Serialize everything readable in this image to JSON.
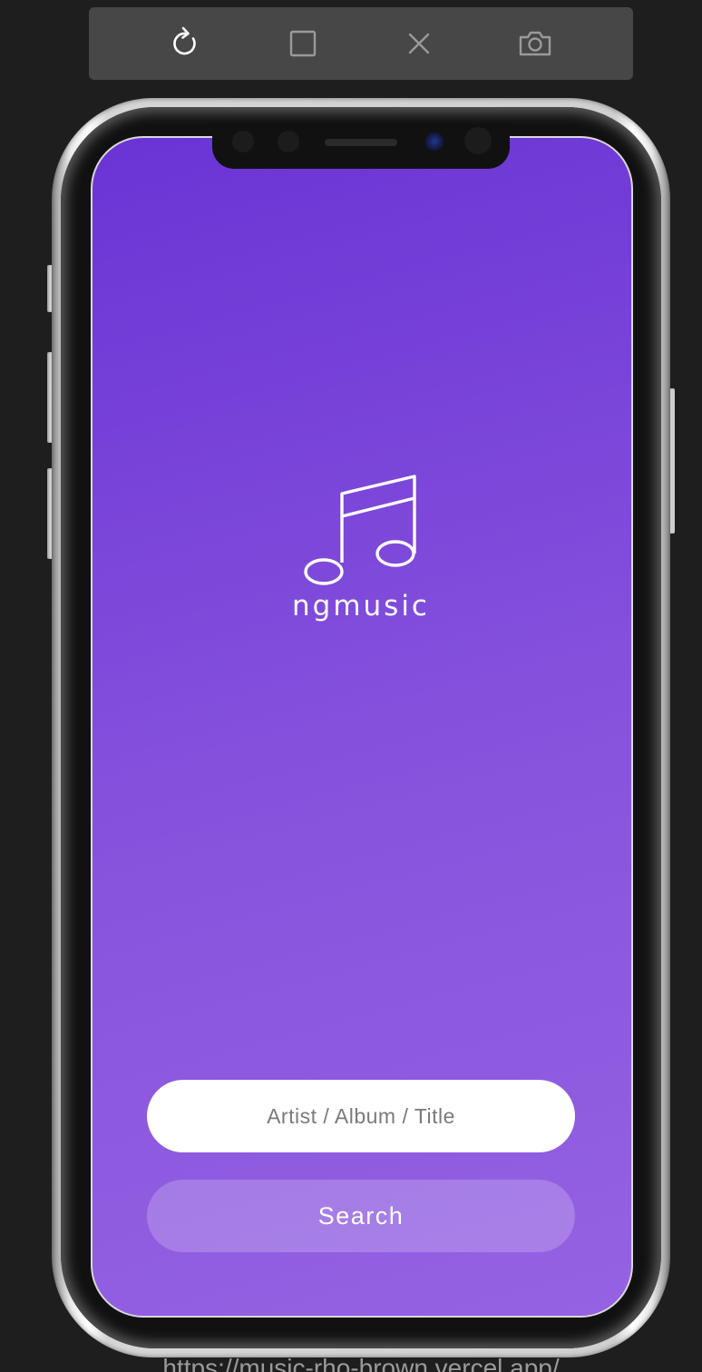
{
  "toolbar": {
    "tools": [
      {
        "name": "refresh-icon",
        "color": "#ffffff"
      },
      {
        "name": "square-icon",
        "color": "#9a9a9a"
      },
      {
        "name": "close-icon",
        "color": "#9a9a9a"
      },
      {
        "name": "camera-icon",
        "color": "#9a9a9a"
      }
    ]
  },
  "app": {
    "logo_icon": "music-note-icon",
    "name": "ngmusic",
    "search": {
      "placeholder": "Artist / Album / Title",
      "value": ""
    },
    "search_button_label": "Search",
    "colors": {
      "gradient_top": "#6a34d5",
      "gradient_bottom": "#9462e2",
      "text": "#ffffff"
    }
  },
  "footer": {
    "url": "https://music-rho-brown.vercel.app/"
  }
}
